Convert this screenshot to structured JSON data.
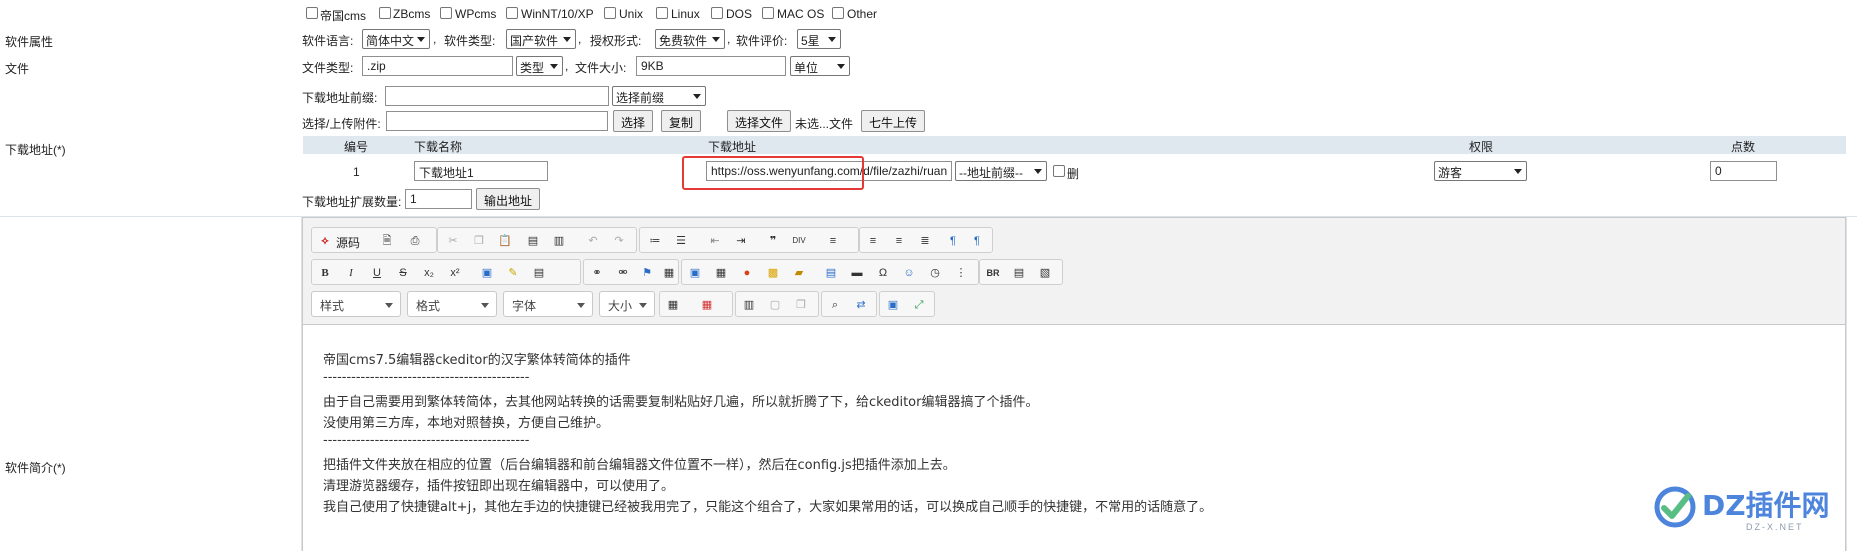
{
  "os_options": [
    "帝国cms",
    "ZBcms",
    "WPcms",
    "WinNT/10/XP",
    "Unix",
    "Linux",
    "DOS",
    "MAC OS",
    "Other"
  ],
  "software_attr": {
    "label": "软件属性",
    "language_label": "软件语言:",
    "language_value": "简体中文",
    "type_label": "软件类型:",
    "type_value": "国产软件",
    "license_label": "授权形式:",
    "license_value": "免费软件",
    "rating_label": "软件评价:",
    "rating_value": "5星"
  },
  "file": {
    "label": "文件",
    "type_label": "文件类型:",
    "type_value": ".zip",
    "type_select": "类型",
    "size_label": "文件大小:",
    "size_value": "9KB",
    "unit_select": "单位"
  },
  "download": {
    "label": "下载地址(*)",
    "prefix_label": "下载地址前缀:",
    "prefix_input": "",
    "prefix_select": "选择前缀",
    "upload_label": "选择/上传附件:",
    "upload_input": "",
    "select_btn": "选择",
    "copy_btn": "复制",
    "choose_file_btn": "选择文件",
    "no_file_text": "未选...文件",
    "qiniu_btn": "七牛上传",
    "table_headers": [
      "编号",
      "下载名称",
      "下载地址",
      "权限",
      "点数"
    ],
    "rows": [
      {
        "no": "1",
        "name": "下载地址1",
        "url": "https://oss.wenyunfang.com/d/file/zazhi/ruan",
        "prefix_select": "--地址前缀--",
        "delete_label": "删",
        "permission": "游客",
        "points": "0"
      }
    ],
    "extend_label": "下载地址扩展数量:",
    "extend_value": "1",
    "export_btn": "输出地址"
  },
  "intro": {
    "label": "软件简介(*)",
    "source_btn": "源码",
    "combos": [
      "样式",
      "格式",
      "字体",
      "大小"
    ],
    "content": [
      "帝国cms7.5编辑器ckeditor的汉字繁体转简体的插件",
      "--------------------------------------------",
      "由于自己需要用到繁体转简体，去其他网站转换的话需要复制粘贴好几遍，所以就折腾了下，给ckeditor编辑器搞了个插件。",
      "没使用第三方库，本地对照替换，方便自己维护。",
      "--------------------------------------------",
      "把插件文件夹放在相应的位置（后台编辑器和前台编辑器文件位置不一样），然后在config.js把插件添加上去。",
      "清理游览器缓存，插件按钮即出现在编辑器中，可以使用了。",
      "我自己使用了快捷键alt+j，其他左手边的快捷键已经被我用完了，只能这个组合了，大家如果常用的话，可以换成自己顺手的快捷键，不常用的话随意了。"
    ]
  },
  "watermark": {
    "brand": "DZ插件网",
    "sub": "DZ-X.NET"
  },
  "colors": {
    "highlight": "#e53935",
    "table_header_bg": "#dfe7ef",
    "watermark_blue": "#2f6fd6",
    "watermark_green": "#3cb371"
  }
}
